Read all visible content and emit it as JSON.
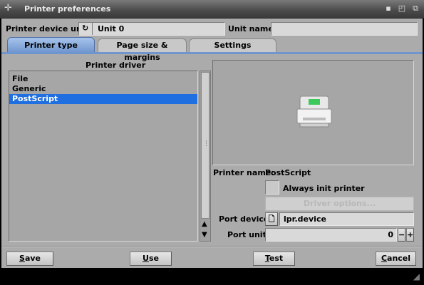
{
  "window": {
    "title": "Printer preferences"
  },
  "top": {
    "device_unit_label": "Printer device unit:",
    "device_unit_value": "Unit 0",
    "unit_name_label": "Unit name:",
    "unit_name_value": ""
  },
  "tabs": [
    {
      "label": "Printer type",
      "active": true
    },
    {
      "label": "Page size & margins",
      "active": false
    },
    {
      "label": "Settings",
      "active": false
    }
  ],
  "driver": {
    "heading": "Printer driver",
    "items": [
      {
        "label": "File",
        "selected": false
      },
      {
        "label": "Generic",
        "selected": false
      },
      {
        "label": "PostScript",
        "selected": true
      }
    ]
  },
  "details": {
    "printer_name_label": "Printer name:",
    "printer_name_value": "PostScript",
    "always_init_label": "Always init printer",
    "always_init_checked": false,
    "driver_options_label": "Driver options...",
    "port_device_label": "Port device:",
    "port_device_value": "lpr.device",
    "port_unit_label": "Port unit:",
    "port_unit_value": "0",
    "minus": "−",
    "plus": "+"
  },
  "buttons": {
    "save": {
      "first": "S",
      "rest": "ave"
    },
    "use": {
      "first": "U",
      "rest": "se"
    },
    "test": {
      "first": "T",
      "rest": "est"
    },
    "cancel": {
      "first": "C",
      "rest": "ancel"
    }
  },
  "colors": {
    "selection": "#1f6fe0",
    "active_tab": "#6f95cf",
    "panel": "#ababab"
  }
}
